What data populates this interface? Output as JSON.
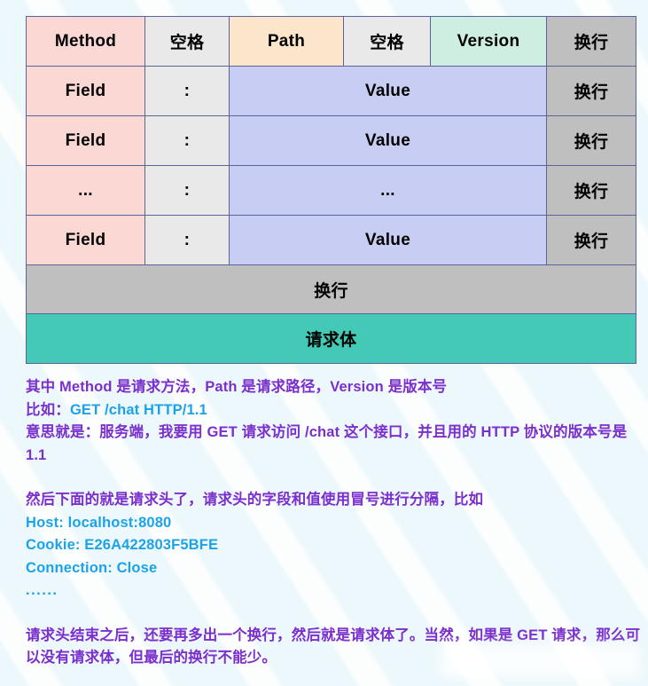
{
  "diagram": {
    "title": "HTTP request message structure table",
    "colors": {
      "method_cell": "#fbd8d3",
      "space_cell": "#e9e9e9",
      "path_cell": "#fce6cb",
      "version_cell": "#cfeee2",
      "newline_cell": "#bfbfbf",
      "value_cell": "#c8cdf4",
      "body_cell": "#44c9b7",
      "border": "#5b6398",
      "page_background": "#edf8fc",
      "prose_text": "#7b2fcc",
      "code_text": "#1ba3e8"
    },
    "rows": [
      {
        "kind": "request-line",
        "cells": [
          {
            "label": "Method",
            "style": "c-method"
          },
          {
            "label": "空格",
            "style": "c-space"
          },
          {
            "label": "Path",
            "style": "c-path"
          },
          {
            "label": "空格",
            "style": "c-space"
          },
          {
            "label": "Version",
            "style": "c-version"
          },
          {
            "label": "换行",
            "style": "c-newline"
          }
        ]
      },
      {
        "kind": "header-line",
        "cells": [
          {
            "label": "Field",
            "style": "c-method"
          },
          {
            "label": ":",
            "style": "c-space"
          },
          {
            "label": "Value",
            "style": "c-value"
          },
          {
            "label": "换行",
            "style": "c-newline"
          }
        ]
      },
      {
        "kind": "header-line",
        "cells": [
          {
            "label": "Field",
            "style": "c-method"
          },
          {
            "label": ":",
            "style": "c-space"
          },
          {
            "label": "Value",
            "style": "c-value"
          },
          {
            "label": "换行",
            "style": "c-newline"
          }
        ]
      },
      {
        "kind": "header-ellipsis",
        "cells": [
          {
            "label": "...",
            "style": "c-method"
          },
          {
            "label": ":",
            "style": "c-space"
          },
          {
            "label": "...",
            "style": "c-value"
          },
          {
            "label": "换行",
            "style": "c-newline"
          }
        ]
      },
      {
        "kind": "header-line",
        "cells": [
          {
            "label": "Field",
            "style": "c-method"
          },
          {
            "label": ":",
            "style": "c-space"
          },
          {
            "label": "Value",
            "style": "c-value"
          },
          {
            "label": "换行",
            "style": "c-newline"
          }
        ]
      },
      {
        "kind": "blank-line",
        "cells": [
          {
            "label": "换行",
            "style": "c-newline"
          }
        ]
      },
      {
        "kind": "request-body",
        "cells": [
          {
            "label": "请求体",
            "style": "c-body"
          }
        ]
      }
    ]
  },
  "prose": {
    "para1": {
      "line1": "其中 Method 是请求方法，Path 是请求路径，Version 是版本号",
      "line2_prefix": "比如：",
      "line2_code": "GET /chat HTTP/1.1",
      "line3": "意思就是：服务端，我要用 GET 请求访问 /chat 这个接口，并且用的 HTTP 协议的版本号是 1.1"
    },
    "para2": {
      "line1": "然后下面的就是请求头了，请求头的字段和值使用冒号进行分隔，比如",
      "header1": "Host: localhost:8080",
      "header2": "Cookie: E26A422803F5BFE",
      "header3": "Connection: Close",
      "ellipsis": "......"
    },
    "para3": {
      "line1": "请求头结束之后，还要再多出一个换行，然后就是请求体了。当然，如果是 GET 请求，那么可以没有请求体，但最后的换行不能少。"
    }
  }
}
